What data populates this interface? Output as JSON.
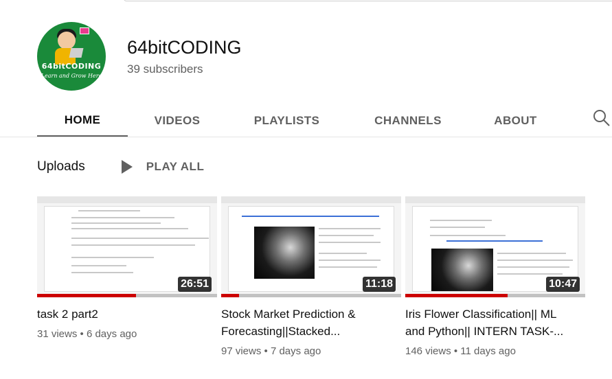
{
  "channel": {
    "name": "64bitCODING",
    "subscribers": "39 subscribers",
    "avatar_text": "64bitCODING",
    "avatar_tagline": "Learn and Grow Here"
  },
  "tabs": [
    {
      "label": "HOME",
      "active": true
    },
    {
      "label": "VIDEOS",
      "active": false
    },
    {
      "label": "PLAYLISTS",
      "active": false
    },
    {
      "label": "CHANNELS",
      "active": false
    },
    {
      "label": "ABOUT",
      "active": false
    }
  ],
  "icons": {
    "search": "search-icon",
    "play": "play-icon"
  },
  "section": {
    "title": "Uploads",
    "play_all_label": "PLAY ALL"
  },
  "videos": [
    {
      "title": "task 2 part2",
      "duration": "26:51",
      "views": "31 views",
      "age": "6 days ago",
      "watched_fraction": 0.55
    },
    {
      "title": "Stock Market Prediction & Forecasting||Stacked...",
      "duration": "11:18",
      "views": "97 views",
      "age": "7 days ago",
      "watched_fraction": 0.1
    },
    {
      "title": "Iris Flower Classification|| ML and Python|| INTERN TASK-...",
      "duration": "10:47",
      "views": "146 views",
      "age": "11 days ago",
      "watched_fraction": 0.57
    }
  ],
  "colors": {
    "avatar_bg": "#1a8a3a",
    "progress": "#cc0000",
    "secondary_text": "#606060"
  }
}
